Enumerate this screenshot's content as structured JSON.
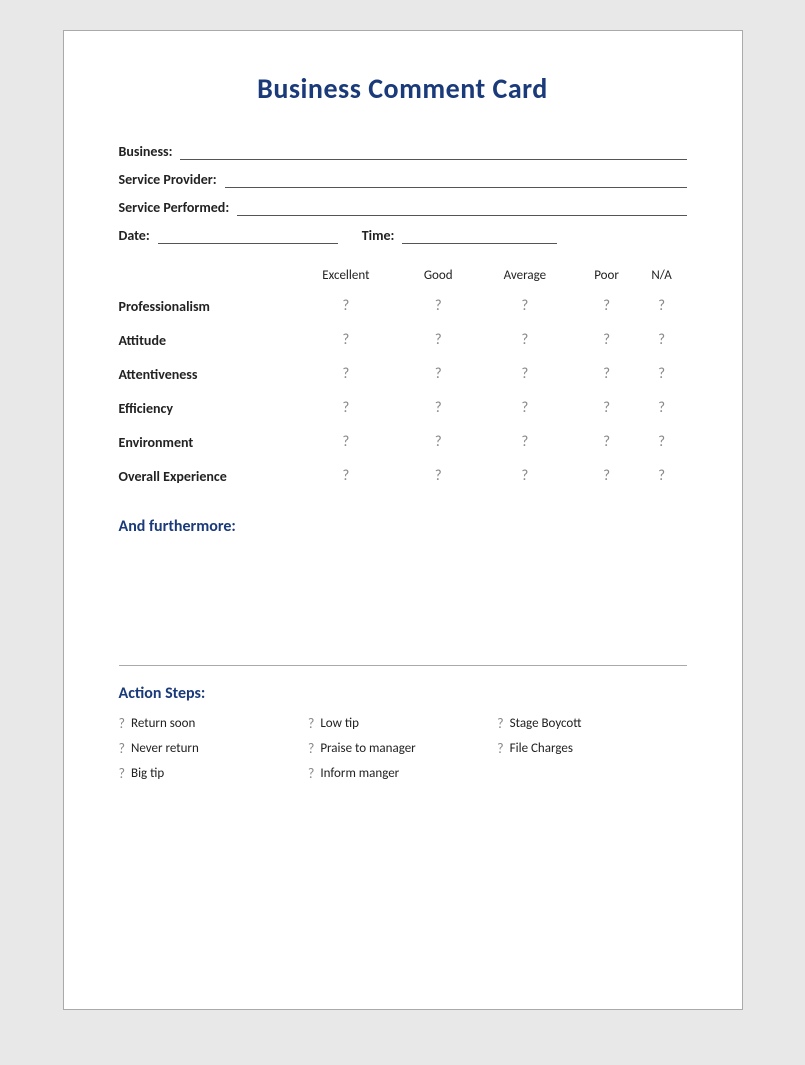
{
  "card": {
    "title": "Business Comment Card",
    "fields": {
      "business_label": "Business:",
      "service_provider_label": "Service Provider:",
      "service_performed_label": "Service Performed:",
      "date_label": "Date:",
      "time_label": "Time:"
    },
    "rating_headers": [
      "",
      "Excellent",
      "Good",
      "Average",
      "Poor",
      "N/A"
    ],
    "rating_rows": [
      {
        "label": "Professionalism"
      },
      {
        "label": "Attitude"
      },
      {
        "label": "Attentiveness"
      },
      {
        "label": "Efficiency"
      },
      {
        "label": "Environment"
      },
      {
        "label": "Overall Experience"
      }
    ],
    "furthermore": {
      "title": "And furthermore:"
    },
    "action_steps": {
      "title": "Action Steps:",
      "items": [
        {
          "col": 0,
          "label": "Return soon"
        },
        {
          "col": 1,
          "label": "Low tip"
        },
        {
          "col": 2,
          "label": "Stage Boycott"
        },
        {
          "col": 0,
          "label": "Never return"
        },
        {
          "col": 1,
          "label": "Praise to manager"
        },
        {
          "col": 2,
          "label": "File Charges"
        },
        {
          "col": 0,
          "label": "Big tip"
        },
        {
          "col": 1,
          "label": "Inform manger"
        }
      ],
      "rows": [
        [
          "Return soon",
          "Low tip",
          "Stage Boycott"
        ],
        [
          "Never return",
          "Praise to manager",
          "File Charges"
        ],
        [
          "Big tip",
          "Inform manger",
          ""
        ]
      ]
    }
  }
}
